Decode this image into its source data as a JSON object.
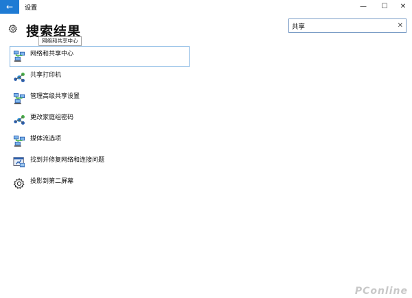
{
  "window": {
    "title": "设置",
    "back_glyph": "←",
    "minimize_glyph": "—",
    "maximize_glyph": "☐",
    "close_glyph": "✕"
  },
  "header": {
    "title": "搜索结果",
    "tooltip": "网络和共享中心"
  },
  "search": {
    "value": "共享",
    "clear_glyph": "✕"
  },
  "results": [
    {
      "label": "网络和共享中心",
      "icon": "network-computers-icon",
      "selected": true
    },
    {
      "label": "共享打印机",
      "icon": "network-share-icon",
      "selected": false
    },
    {
      "label": "管理高级共享设置",
      "icon": "network-computers-icon",
      "selected": false
    },
    {
      "label": "更改家庭组密码",
      "icon": "network-share-icon",
      "selected": false
    },
    {
      "label": "媒体流选项",
      "icon": "network-computers-icon",
      "selected": false
    },
    {
      "label": "找到并修复网络和连接问题",
      "icon": "troubleshoot-network-icon",
      "selected": false
    },
    {
      "label": "投影到第二屏幕",
      "icon": "gear-icon",
      "selected": false
    }
  ],
  "watermark": "PConline",
  "colors": {
    "accent": "#1e7bd4",
    "selection_border": "#7ab0e0",
    "search_border": "#7a9cc6"
  }
}
